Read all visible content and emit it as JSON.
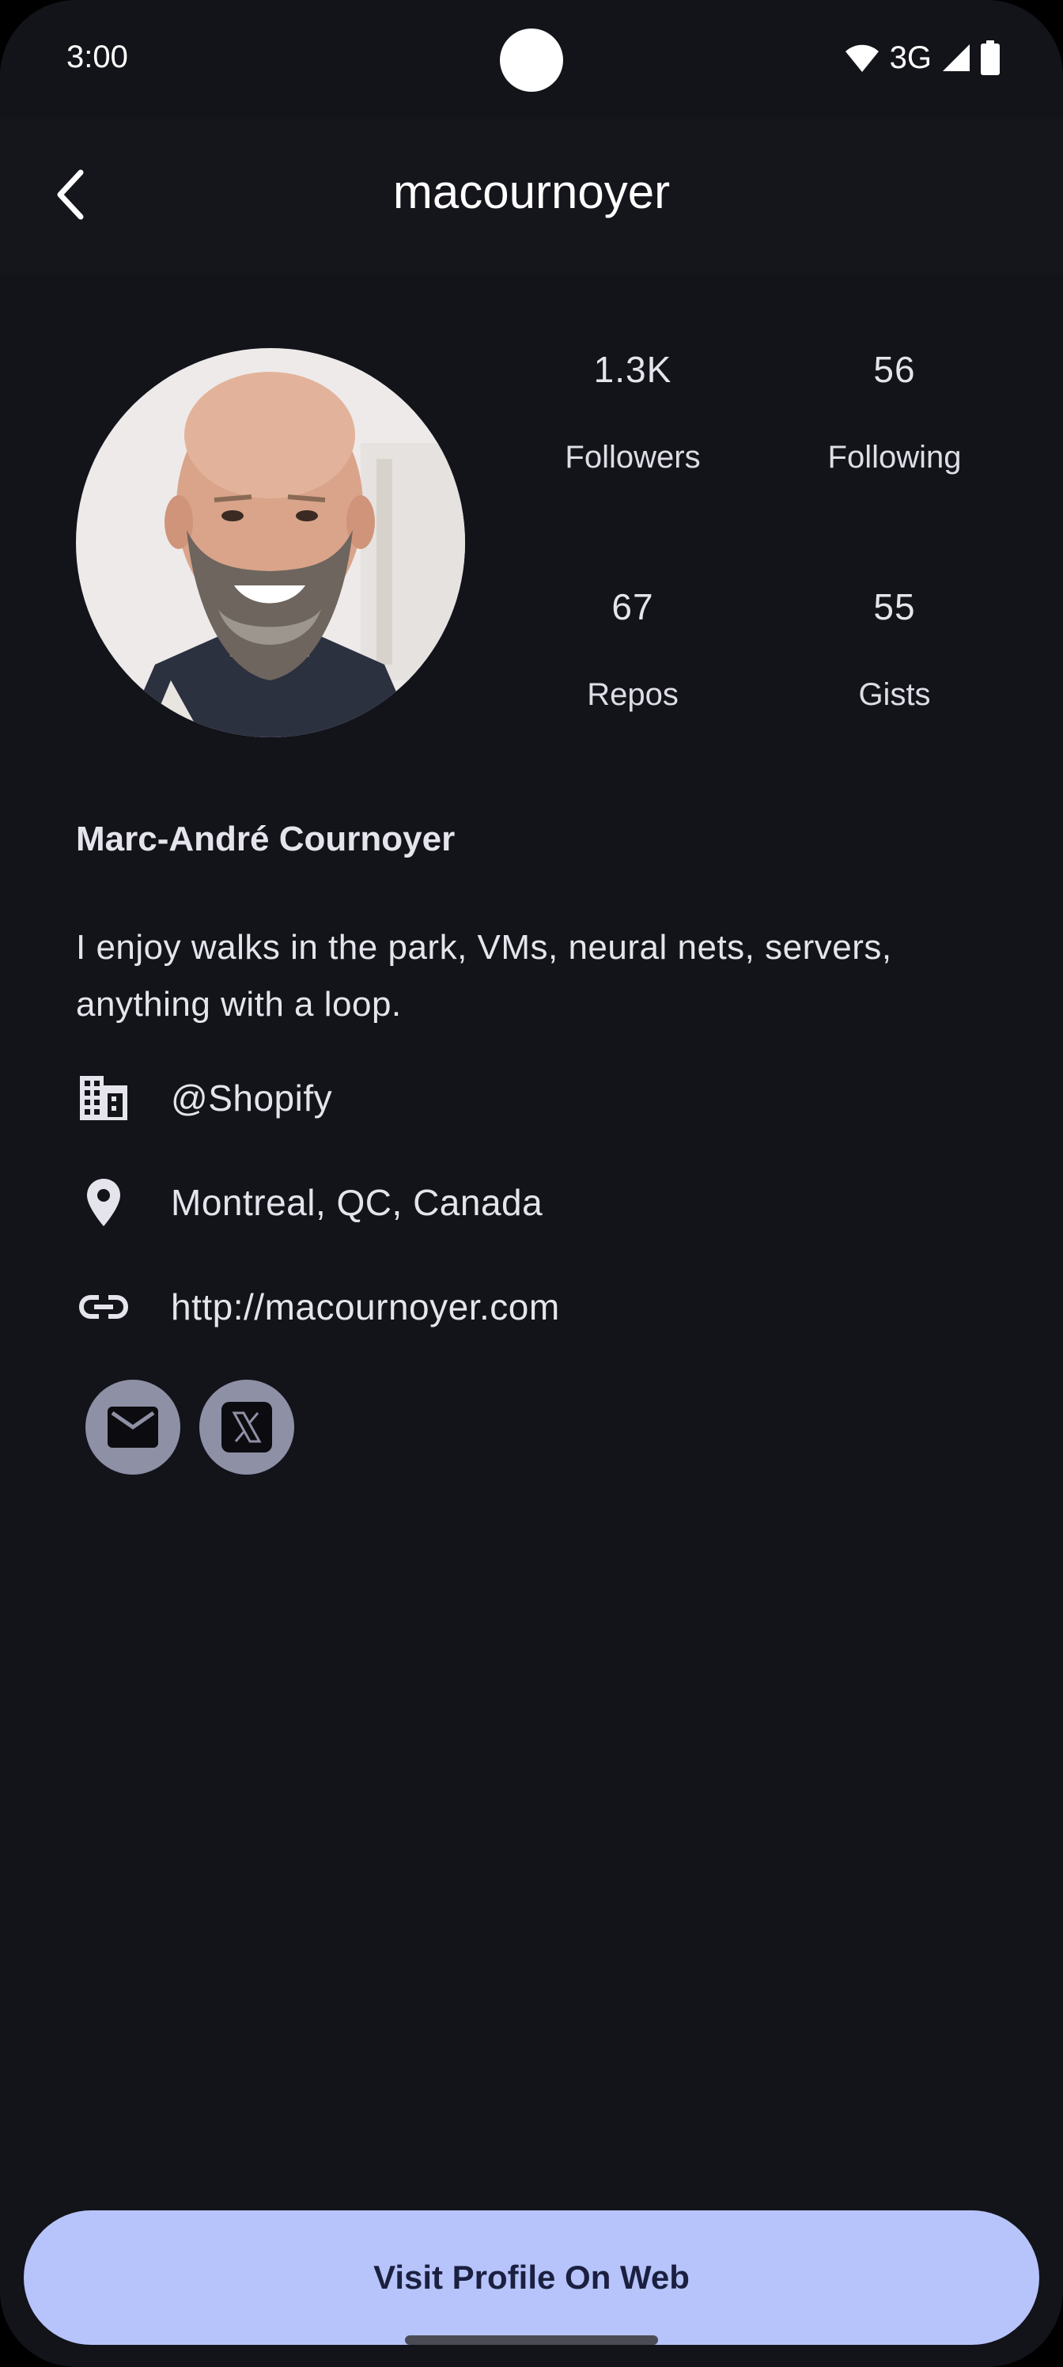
{
  "status_bar": {
    "time": "3:00",
    "network": "3G",
    "icons": [
      "wifi-icon",
      "cell-signal-icon",
      "battery-icon"
    ]
  },
  "app_bar": {
    "title": "macournoyer",
    "back_icon": "chevron-left-icon"
  },
  "profile": {
    "avatar_alt": "profile photo",
    "full_name": "Marc-André Cournoyer",
    "bio": "I enjoy walks in the park, VMs, neural nets, servers, anything with a loop.",
    "stats": [
      {
        "value": "1.3K",
        "label": "Followers"
      },
      {
        "value": "56",
        "label": "Following"
      },
      {
        "value": "67",
        "label": "Repos"
      },
      {
        "value": "55",
        "label": "Gists"
      }
    ],
    "company": {
      "icon": "building-icon",
      "text": "@Shopify"
    },
    "location": {
      "icon": "location-pin-icon",
      "text": "Montreal, QC, Canada"
    },
    "website": {
      "icon": "link-icon",
      "text": "http://macournoyer.com"
    },
    "socials": [
      {
        "icon": "email-icon"
      },
      {
        "icon": "x-twitter-icon"
      }
    ]
  },
  "actions": {
    "visit_web_label": "Visit Profile On Web"
  },
  "colors": {
    "background": "#13131a",
    "app_bar": "#15151c",
    "accent_button": "#b7c4fb",
    "social_button": "#8e90a6"
  }
}
